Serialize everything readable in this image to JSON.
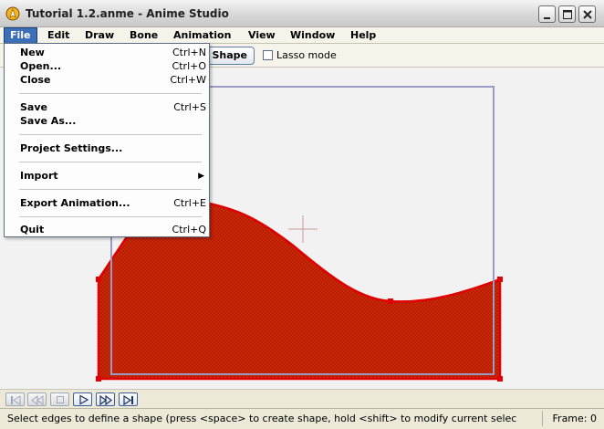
{
  "window": {
    "title": "Tutorial 1.2.anme - Anime Studio",
    "icons": [
      "app-logo-icon",
      "minimize-icon",
      "maximize-icon",
      "close-icon"
    ]
  },
  "menubar": {
    "items": [
      "File",
      "Edit",
      "Draw",
      "Bone",
      "Animation",
      "View",
      "Window",
      "Help"
    ],
    "active": "File"
  },
  "file_menu": {
    "items": [
      {
        "label": "New",
        "shortcut": "Ctrl+N"
      },
      {
        "label": "Open...",
        "shortcut": "Ctrl+O"
      },
      {
        "label": "Close",
        "shortcut": "Ctrl+W"
      },
      {
        "label": "Save",
        "shortcut": "Ctrl+S"
      },
      {
        "label": "Save As...",
        "shortcut": ""
      },
      {
        "label": "Project Settings...",
        "shortcut": ""
      },
      {
        "label": "Import",
        "shortcut": "",
        "submenu_arrow": "▶"
      },
      {
        "label": "Export Animation...",
        "shortcut": "Ctrl+E"
      },
      {
        "label": "Quit",
        "shortcut": "Ctrl+Q"
      }
    ]
  },
  "toolbar": {
    "shape_button": "Shape",
    "lasso_label": "Lasso mode",
    "lasso_checked": false
  },
  "canvas": {
    "shape_fill": "#cc2200",
    "frame_color": "#9a9ac4",
    "point_color": "#dd0000"
  },
  "timeline": {
    "buttons": [
      "rewind-icon",
      "step-back-icon",
      "stop-icon",
      "play-icon",
      "step-forward-icon",
      "fast-forward-icon"
    ]
  },
  "status": {
    "text": "Select edges to define a shape (press <space> to create shape, hold <shift> to modify current selec",
    "frame": "Frame: 0"
  }
}
